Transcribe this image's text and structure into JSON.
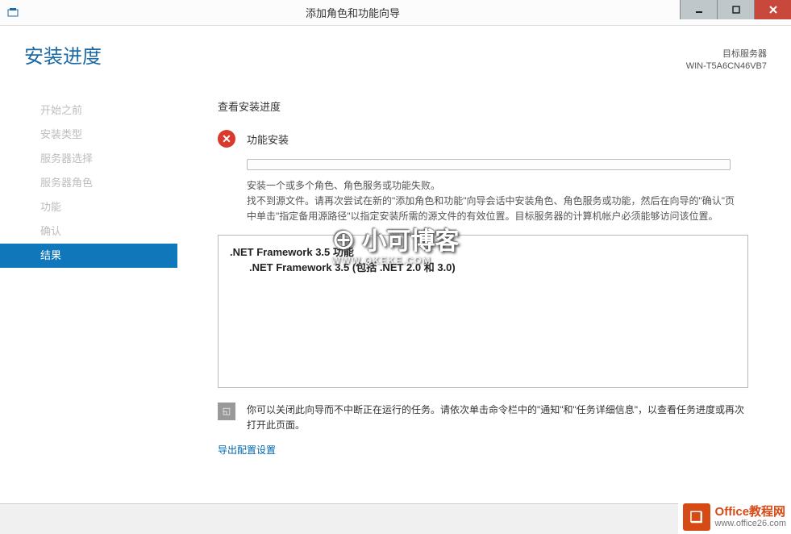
{
  "titlebar": {
    "title": "添加角色和功能向导"
  },
  "header": {
    "page_title": "安装进度",
    "target_label": "目标服务器",
    "target_name": "WIN-T5A6CN46VB7"
  },
  "sidebar": {
    "items": [
      {
        "label": "开始之前",
        "active": false
      },
      {
        "label": "安装类型",
        "active": false
      },
      {
        "label": "服务器选择",
        "active": false
      },
      {
        "label": "服务器角色",
        "active": false
      },
      {
        "label": "功能",
        "active": false
      },
      {
        "label": "确认",
        "active": false
      },
      {
        "label": "结果",
        "active": true
      }
    ]
  },
  "content": {
    "section_title": "查看安装进度",
    "status_label": "功能安装",
    "msg1": "安装一个或多个角色、角色服务或功能失败。",
    "msg2": "找不到源文件。请再次尝试在新的\"添加角色和功能\"向导会话中安装角色、角色服务或功能，然后在向导的\"确认\"页中单击\"指定备用源路径\"以指定安装所需的源文件的有效位置。目标服务器的计算机帐户必须能够访问该位置。",
    "feature_line1": ".NET Framework 3.5 功能",
    "feature_line2": ".NET Framework 3.5 (包括 .NET 2.0 和 3.0)",
    "note": "你可以关闭此向导而不中断正在运行的任务。请依次单击命令栏中的\"通知\"和\"任务详细信息\"，以查看任务进度或再次打开此页面。",
    "export_link": "导出配置设置"
  },
  "watermark": {
    "main": "⊕ 小可博客",
    "sub": "WWW.QKEKE.COM"
  },
  "badge": {
    "line1": "Office教程网",
    "line2": "www.office26.com"
  }
}
